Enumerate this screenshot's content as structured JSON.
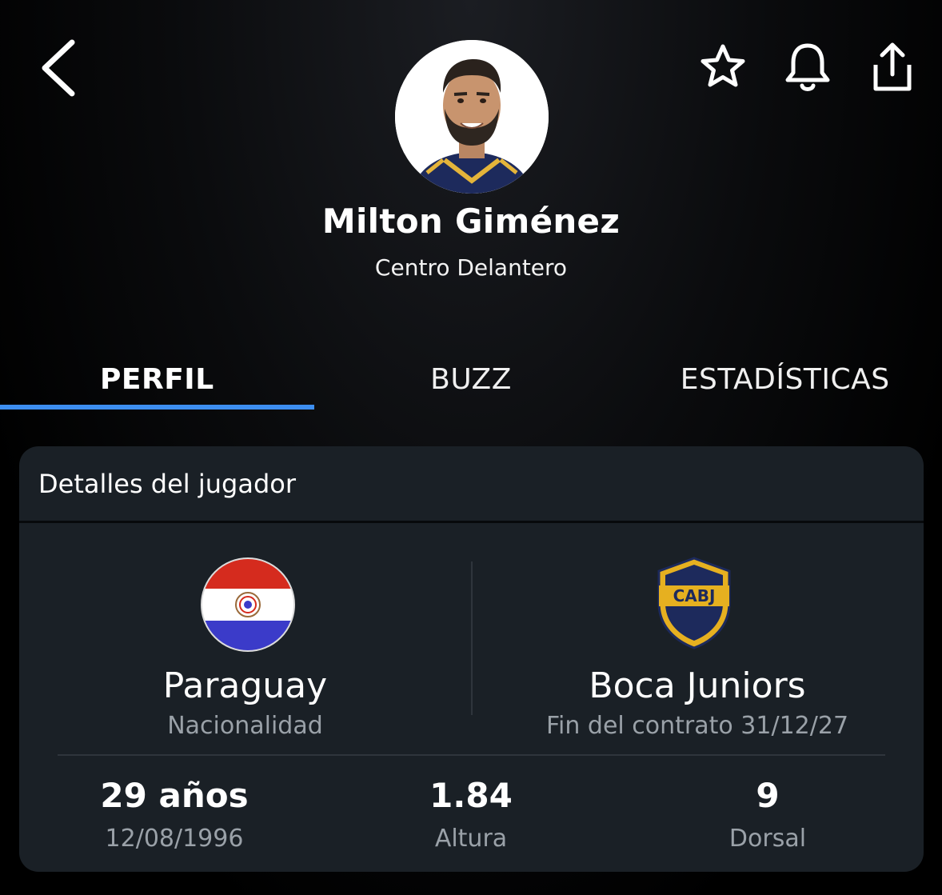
{
  "header": {
    "back_icon": "chevron-left-icon",
    "actions": [
      {
        "icon": "star-icon"
      },
      {
        "icon": "bell-icon"
      },
      {
        "icon": "share-icon"
      }
    ]
  },
  "player": {
    "name": "Milton Giménez",
    "position": "Centro Delantero"
  },
  "tabs": [
    {
      "label": "PERFIL",
      "active": true
    },
    {
      "label": "BUZZ",
      "active": false
    },
    {
      "label": "ESTADÍSTICAS",
      "active": false
    }
  ],
  "details": {
    "title": "Detalles del jugador",
    "nationality": {
      "value": "Paraguay",
      "label": "Nacionalidad"
    },
    "club": {
      "value": "Boca Juniors",
      "label": "Fin del contrato 31/12/27",
      "crest_text": "CABJ"
    },
    "age": {
      "value": "29 años",
      "label": "12/08/1996"
    },
    "height": {
      "value": "1.84",
      "label": "Altura"
    },
    "number": {
      "value": "9",
      "label": "Dorsal"
    }
  },
  "colors": {
    "accent": "#3d8ef0",
    "card_bg": "#1a2026",
    "muted_text": "#9aa1a8"
  }
}
